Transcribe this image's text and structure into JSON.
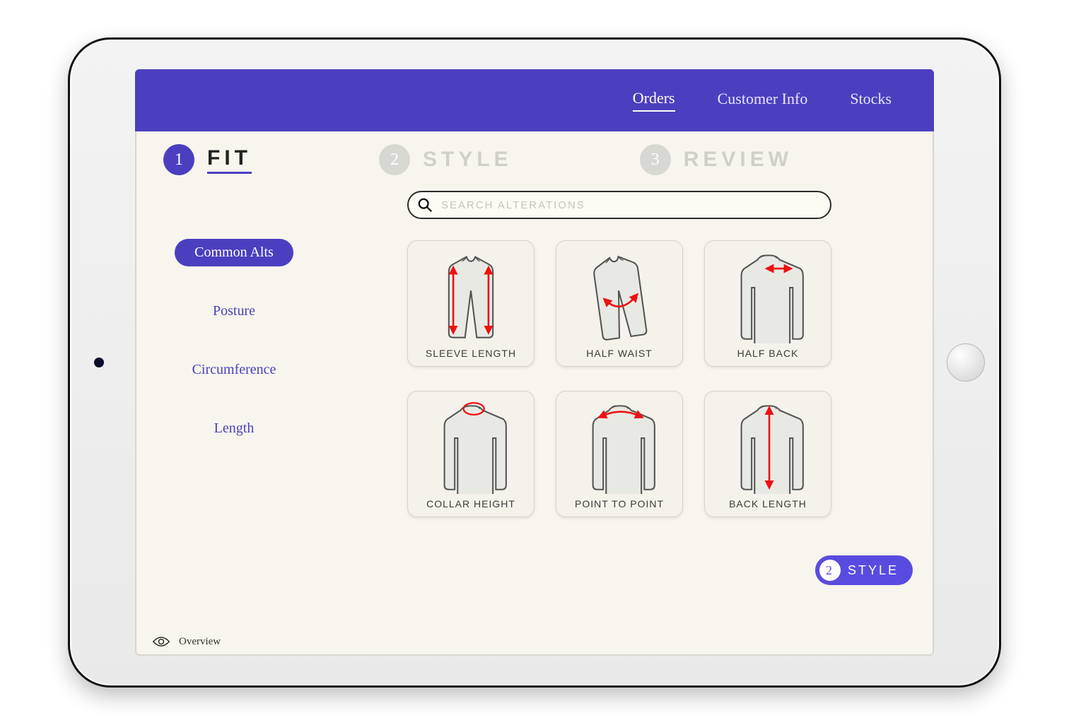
{
  "topnav": {
    "items": [
      {
        "label": "Orders",
        "active": true
      },
      {
        "label": "Customer Info",
        "active": false
      },
      {
        "label": "Stocks",
        "active": false
      }
    ]
  },
  "steps": [
    {
      "num": "1",
      "label": "FIT",
      "active": true
    },
    {
      "num": "2",
      "label": "STYLE",
      "active": false
    },
    {
      "num": "3",
      "label": "REVIEW",
      "active": false
    }
  ],
  "search": {
    "placeholder": "SEARCH ALTERATIONS"
  },
  "sidebar": {
    "items": [
      {
        "label": "Common Alts",
        "active": true
      },
      {
        "label": "Posture",
        "active": false
      },
      {
        "label": "Circumference",
        "active": false
      },
      {
        "label": "Length",
        "active": false
      }
    ]
  },
  "cards": [
    {
      "label": "SLEEVE LENGTH",
      "icon": "sleeve-length"
    },
    {
      "label": "HALF WAIST",
      "icon": "half-waist"
    },
    {
      "label": "HALF BACK",
      "icon": "half-back"
    },
    {
      "label": "COLLAR HEIGHT",
      "icon": "collar-height"
    },
    {
      "label": "POINT TO POINT",
      "icon": "point-to-point"
    },
    {
      "label": "BACK LENGTH",
      "icon": "back-length"
    }
  ],
  "next": {
    "num": "2",
    "label": "STYLE"
  },
  "footer": {
    "overview": "Overview"
  }
}
